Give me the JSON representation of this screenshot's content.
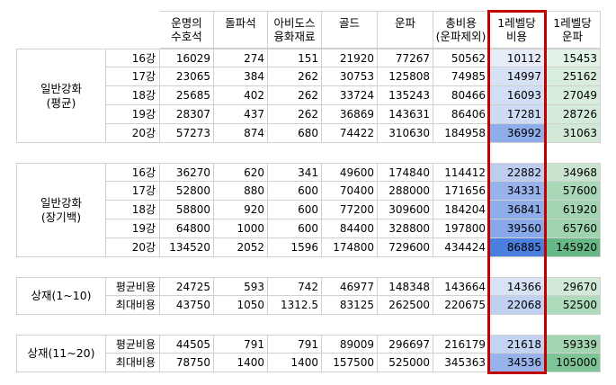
{
  "headers": [
    "운명의\n수호석",
    "돌파석",
    "아비도스\n융화재료",
    "골드",
    "운파",
    "총비용\n(운파제외)",
    "1레벨당\n비용",
    "1레벨당\n운파"
  ],
  "groups": [
    {
      "label": "일반강화\n(평균)",
      "rows": [
        {
          "level": "16강",
          "values": [
            "16029",
            "274",
            "151",
            "21920",
            "77267",
            "50562",
            "10112",
            "15453"
          ],
          "c1": "#e6edf9",
          "c2": "#e3f2e6"
        },
        {
          "level": "17강",
          "values": [
            "23065",
            "384",
            "262",
            "30753",
            "125808",
            "74985",
            "14997",
            "25162"
          ],
          "c1": "#d6e1f6",
          "c2": "#d9eddd"
        },
        {
          "level": "18강",
          "values": [
            "25685",
            "402",
            "262",
            "33724",
            "135243",
            "80466",
            "16093",
            "27049"
          ],
          "c1": "#d2def5",
          "c2": "#d7ecdb"
        },
        {
          "level": "19강",
          "values": [
            "28307",
            "437",
            "262",
            "36869",
            "143631",
            "86406",
            "17281",
            "28726"
          ],
          "c1": "#cfdbf4",
          "c2": "#d4eadb"
        },
        {
          "level": "20강",
          "values": [
            "57273",
            "874",
            "680",
            "74422",
            "310630",
            "184958",
            "36992",
            "31063"
          ],
          "c1": "#8fadea",
          "c2": "#d2e9d7"
        }
      ]
    },
    {
      "label": "일반강화\n(장기백)",
      "rows": [
        {
          "level": "16강",
          "values": [
            "36270",
            "620",
            "341",
            "49600",
            "174840",
            "114412",
            "22882",
            "34968"
          ],
          "c1": "#bccdf0",
          "c2": "#c9e5d0"
        },
        {
          "level": "17강",
          "values": [
            "52800",
            "880",
            "600",
            "70400",
            "288000",
            "171656",
            "34331",
            "57600"
          ],
          "c1": "#98b3eb",
          "c2": "#a9d8b8"
        },
        {
          "level": "18강",
          "values": [
            "58800",
            "920",
            "600",
            "77200",
            "309600",
            "184204",
            "36841",
            "61920"
          ],
          "c1": "#8fadea",
          "c2": "#a4d5b3"
        },
        {
          "level": "19강",
          "values": [
            "64800",
            "1000",
            "600",
            "84400",
            "328800",
            "197800",
            "39560",
            "65760"
          ],
          "c1": "#88a8e9",
          "c2": "#9fd2ae"
        },
        {
          "level": "20강",
          "values": [
            "134520",
            "2052",
            "1596",
            "174800",
            "729600",
            "434424",
            "86885",
            "145920"
          ],
          "c1": "#4a7fe0",
          "c2": "#66b886"
        }
      ]
    },
    {
      "label": "상재(1~10)",
      "rows": [
        {
          "level": "평균비용",
          "values": [
            "24725",
            "593",
            "742",
            "46977",
            "148348",
            "143664",
            "14366",
            "29670"
          ],
          "c1": "#d8e3f6",
          "c2": "#d1e9d6"
        },
        {
          "level": "최대비용",
          "values": [
            "43750",
            "1050",
            "1312.5",
            "83125",
            "262500",
            "220675",
            "22068",
            "52500"
          ],
          "c1": "#bfd0f1",
          "c2": "#afdbbd"
        }
      ]
    },
    {
      "label": "상재(11~20)",
      "rows": [
        {
          "level": "평균비용",
          "values": [
            "44505",
            "791",
            "791",
            "89009",
            "296697",
            "216179",
            "21618",
            "59339"
          ],
          "c1": "#c3d3f1",
          "c2": "#a3d4b2"
        },
        {
          "level": "최대비용",
          "values": [
            "78750",
            "1400",
            "1400",
            "157500",
            "525000",
            "345363",
            "34536",
            "105000"
          ],
          "c1": "#98b3eb",
          "c2": "#7fc497"
        }
      ]
    }
  ]
}
